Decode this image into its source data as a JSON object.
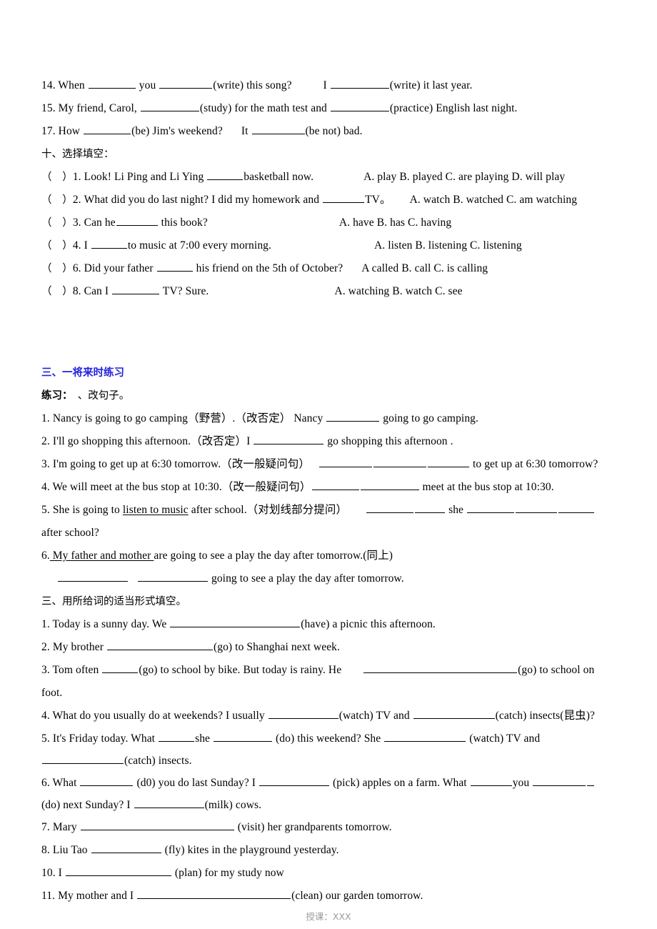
{
  "document": {
    "footer": "授课：XXX"
  },
  "section_fill_past": {
    "items": [
      {
        "id": "14",
        "number": "14. ",
        "p1": "When ",
        "p2": " you ",
        "p3": "(write) this song?",
        "p4": "I ",
        "p5": "(write) it last year."
      },
      {
        "id": "15",
        "number": "15. ",
        "p1": "My friend, Carol, ",
        "p2": "(study) for the math test and ",
        "p3": "(practice) English last night."
      },
      {
        "id": "17",
        "number": "17. ",
        "p1": "How ",
        "p2": "(be) Jim's weekend?",
        "p3": "It ",
        "p4": "(be not) bad."
      }
    ]
  },
  "section_mc": {
    "heading": "十、选择填空：",
    "items": [
      {
        "bracket": "（　）",
        "number": "1. ",
        "stem_a": "Look! Li Ping and Li Ying ",
        "stem_b": "basketball now.",
        "options": "A. play  B. played  C. are playing D. will play"
      },
      {
        "bracket": "（　）",
        "number": "2. ",
        "stem_a": "What did you do last night?   I did my homework and ",
        "stem_b": "TV。",
        "options": "A. watch    B. watched    C. am watching"
      },
      {
        "bracket": "（　）",
        "number": "3. ",
        "stem_a": "Can he",
        "stem_b": " this book?",
        "options": "A. have    B. has     C. having"
      },
      {
        "bracket": "（　）",
        "number": "4. ",
        "stem_a": "I ",
        "stem_b": "to music at 7:00 every morning.",
        "options": "A. listen    B. listening     C. listening"
      },
      {
        "bracket": "（　）",
        "number": "6. ",
        "stem_a": "Did your father ",
        "stem_b": " his friend on the 5th of October?",
        "options": "A called  B. call  C. is calling"
      },
      {
        "bracket": "（　）",
        "number": "8. ",
        "stem_a": "Can I ",
        "stem_b": " TV?  Sure.",
        "options": "A. watching     B. watch     C. see"
      }
    ]
  },
  "section_future": {
    "heading": "三、一将来时练习",
    "subheading_bold": "练习：",
    "subheading_rest": "　、改句子。",
    "items": [
      {
        "number": "1. ",
        "p1": "Nancy is going to go camping（野营）.（改否定）  Nancy ",
        "p2": " going to go camping."
      },
      {
        "number": "2. ",
        "p1": "I'll go shopping   this afternoon.（改否定）I ",
        "p2": " go shopping   this afternoon ."
      },
      {
        "number": "3. ",
        "p1": "I'm going to get up at 6:30 tomorrow.（改一般疑问句）",
        "p2": " to get up at 6:30 tomorrow?"
      },
      {
        "number": "4. ",
        "p1": "We will meet at the bus stop at 10:30.（改一般疑问句）",
        "p2": " meet at the bus stop at 10:30."
      },
      {
        "number": "5. ",
        "p1": "She is going to ",
        "underlined": "listen to music",
        "p2": " after school.（对划线部分提问）",
        "p3": " she ",
        "p4": " after school?"
      },
      {
        "number": "6.",
        "underlined": " My father and mother ",
        "p1": "are going to see a play the day after tomorrow.(同上)",
        "p2": " going to see a play the day after tomorrow."
      }
    ]
  },
  "section_forms": {
    "heading": "三、用所给词的适当形式填空。",
    "items": [
      {
        "number": "1. ",
        "p1": "Today is a sunny day. We ",
        "p2": "(have) a picnic this afternoon."
      },
      {
        "number": "2. ",
        "p1": "My brother ",
        "p2": "(go) to Shanghai next week."
      },
      {
        "number": "3. ",
        "p1": "Tom often ",
        "p2": "(go) to school by bike. But today is rainy. He ",
        "p3": "(go) to school on foot."
      },
      {
        "number": "4. ",
        "p1": "What do you usually do at weekends? I usually ",
        "p2": "(watch) TV and ",
        "p3": "(catch) insects(昆虫)?"
      },
      {
        "number": "5. ",
        "p1": "It's Friday today. What ",
        "p2": "she ",
        "p3": " (do) this weekend? She ",
        "p4": " (watch) TV and ",
        "p5": "(catch) insects."
      },
      {
        "number": "6. ",
        "p1": "What ",
        "p2": "  (d0) you do last Sunday? I ",
        "p3": "   (pick) apples on a farm. What ",
        "p4": "you ",
        "p5": "  (do) next Sunday? I ",
        "p6": "(milk) cows."
      },
      {
        "number": "7. ",
        "p1": "Mary ",
        "p2": " (visit) her grandparents tomorrow."
      },
      {
        "number": "8. ",
        "p1": "Liu Tao ",
        "p2": " (fly) kites in the playground yesterday."
      },
      {
        "number": "10. ",
        "p1": "I ",
        "p2": " (plan) for my study now"
      },
      {
        "number": "11. ",
        "p1": "My mother and I ",
        "p2": "(clean) our garden tomorrow."
      }
    ]
  }
}
